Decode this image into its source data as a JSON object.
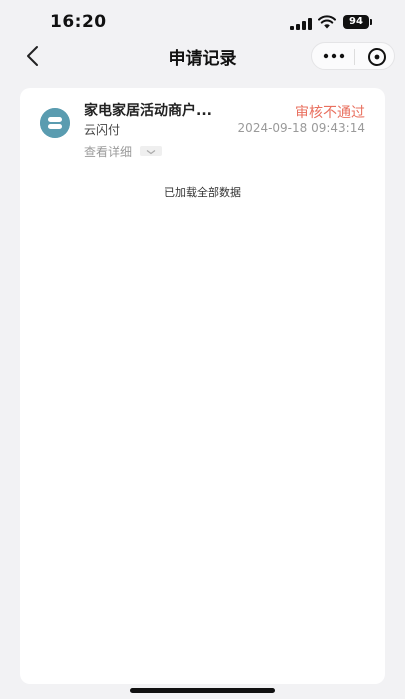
{
  "status_bar": {
    "time": "16:20",
    "battery": "94"
  },
  "nav": {
    "title": "申请记录",
    "back_icon": "chevron-left-icon",
    "more_icon": "more-dots-icon",
    "close_icon": "circle-close-icon"
  },
  "records": [
    {
      "title": "家电家居活动商户...",
      "status": "审核不通过",
      "subtitle": "云闪付",
      "time": "2024-09-18 09:43:14",
      "details_label": "查看详细"
    }
  ],
  "list_end_text": "已加载全部数据",
  "colors": {
    "status_rejected": "#e9705f",
    "logo": "#5a9cb0",
    "background": "#f2f2f4"
  }
}
